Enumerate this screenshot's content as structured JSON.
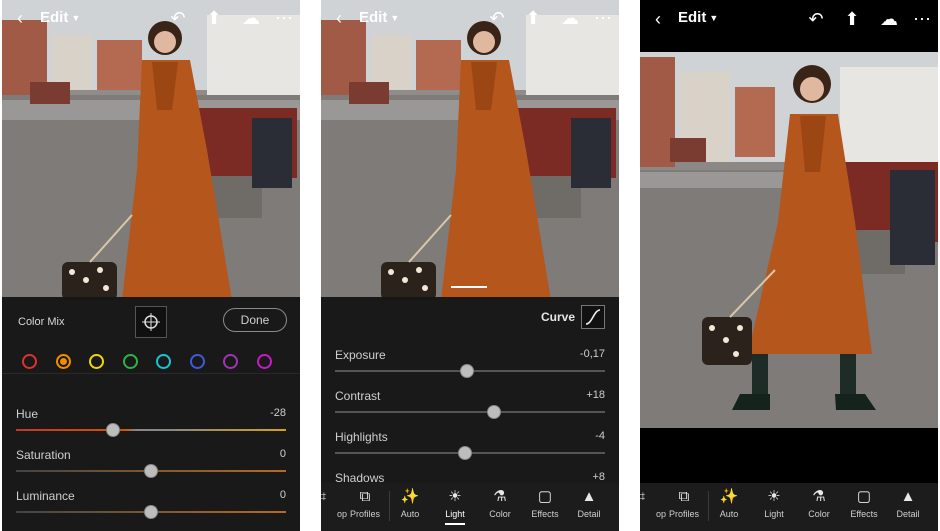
{
  "app": {
    "edit_label": "Edit"
  },
  "colormix": {
    "title": "Color Mix",
    "done_label": "Done",
    "swatches": [
      "#e03131",
      "#f08c00",
      "#f2d600",
      "#2fb344",
      "#18c4d6",
      "#3b5bdb",
      "#9c36b5",
      "#c71ac9"
    ],
    "sliders": [
      {
        "label": "Hue",
        "value": "-28",
        "pos": 0.36
      },
      {
        "label": "Saturation",
        "value": "0",
        "pos": 0.5
      },
      {
        "label": "Luminance",
        "value": "0",
        "pos": 0.5
      }
    ]
  },
  "light": {
    "curve_label": "Curve",
    "sliders": [
      {
        "label": "Exposure",
        "value": "-0,17",
        "pos": 0.49
      },
      {
        "label": "Contrast",
        "value": "+18",
        "pos": 0.59
      },
      {
        "label": "Highlights",
        "value": "-4",
        "pos": 0.48
      },
      {
        "label": "Shadows",
        "value": "+8",
        "pos": 0.52
      }
    ]
  },
  "toolbar": {
    "items": [
      {
        "label": "Crop",
        "icon": "crop-icon"
      },
      {
        "label": "Profiles",
        "icon": "profiles-icon"
      },
      {
        "label": "Auto",
        "icon": "auto-icon"
      },
      {
        "label": "Light",
        "icon": "light-icon"
      },
      {
        "label": "Color",
        "icon": "color-icon"
      },
      {
        "label": "Effects",
        "icon": "effects-icon"
      },
      {
        "label": "Detail",
        "icon": "detail-icon"
      }
    ],
    "visible_labels": [
      "op",
      "Profiles",
      "Auto",
      "Light",
      "Color",
      "Effects",
      "Detail"
    ]
  },
  "colors": {
    "panel_bg": "#161616",
    "coat": "#b5561c",
    "accent": "#ffffff"
  }
}
